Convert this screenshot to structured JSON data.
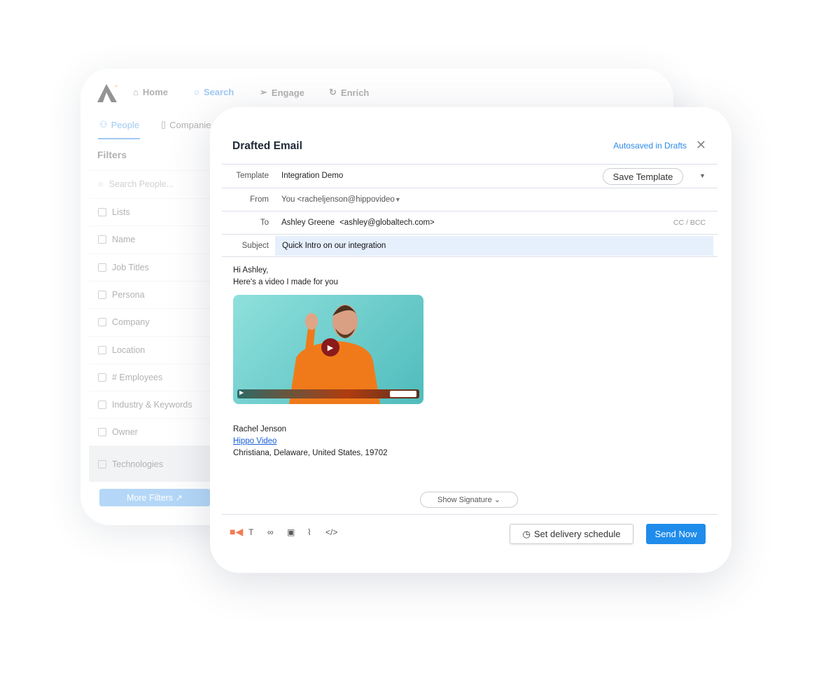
{
  "back_app": {
    "nav": [
      {
        "label": "Home",
        "icon": "home-icon"
      },
      {
        "label": "Search",
        "icon": "search-icon"
      },
      {
        "label": "Engage",
        "icon": "send-icon"
      },
      {
        "label": "Enrich",
        "icon": "refresh-icon"
      }
    ],
    "tabs": [
      {
        "label": "People"
      },
      {
        "label": "Companie"
      }
    ],
    "filters_title": "Filters",
    "search_placeholder": "Search People...",
    "filters": [
      "Lists",
      "Name",
      "Job Titles",
      "Persona",
      "Company",
      "Location",
      "# Employees",
      "Industry & Keywords",
      "Owner",
      "Technologies"
    ],
    "more_filters": "More Filters"
  },
  "email": {
    "title": "Drafted Email",
    "autosave": "Autosaved in Drafts",
    "template_label": "Template",
    "template_value": "Integration Demo",
    "save_template": "Save Template",
    "from_label": "From",
    "from_value": "You <racheljenson@hippovideo",
    "to_label": "To",
    "to_name": "Ashley Greene",
    "to_email": "<ashley@globaltech.com>",
    "cc_bcc": "CC / BCC",
    "subject_label": "Subject",
    "subject_value": "Quick Intro on our integration",
    "greeting": "Hi Ashley,",
    "line1": "Here's a video I made for you",
    "sig_name": "Rachel Jenson",
    "sig_link": "Hippo Video",
    "sig_address": "Christiana, Delaware, United States, 19702",
    "show_signature": "Show Signature ⌄",
    "schedule": "Set delivery schedule",
    "send": "Send Now",
    "accent": "#1f8ceb"
  }
}
